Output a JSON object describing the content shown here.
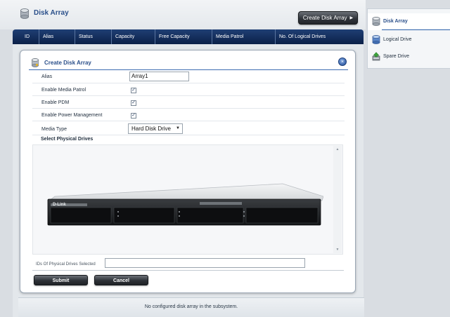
{
  "header": {
    "title": "Disk Array",
    "create_button": "Create Disk Array"
  },
  "table": {
    "columns": [
      "ID",
      "Alias",
      "Status",
      "Capacity",
      "Free Capacity",
      "Media Patrol",
      "No. Of Logical Drives"
    ]
  },
  "dialog": {
    "title": "Create Disk Array",
    "fields": {
      "alias_label": "Alias",
      "alias_value": "Array1",
      "media_patrol_label": "Enable Media Patrol",
      "media_patrol_checked": true,
      "pdm_label": "Enable PDM",
      "pdm_checked": true,
      "power_label": "Enable Power Management",
      "power_checked": true,
      "media_type_label": "Media Type",
      "media_type_value": "Hard Disk Drive"
    },
    "drives_heading": "Select Physical Drives",
    "device_brand": "D-Link",
    "ids_label": "IDs Of Physical Drives Selected",
    "ids_value": "",
    "submit_label": "Submit",
    "cancel_label": "Cancel"
  },
  "status": {
    "message": "No configured disk array in the subsystem."
  },
  "sidebar": {
    "items": [
      {
        "label": "Disk Array",
        "icon": "disk-array-icon",
        "active": true
      },
      {
        "label": "Logical Drive",
        "icon": "logical-drive-icon",
        "active": false
      },
      {
        "label": "Spare Drive",
        "icon": "spare-drive-icon",
        "active": false
      }
    ]
  },
  "colors": {
    "accent": "#2a4f8a",
    "header_bar": "#0b2048",
    "button_dark": "#2d3137"
  }
}
